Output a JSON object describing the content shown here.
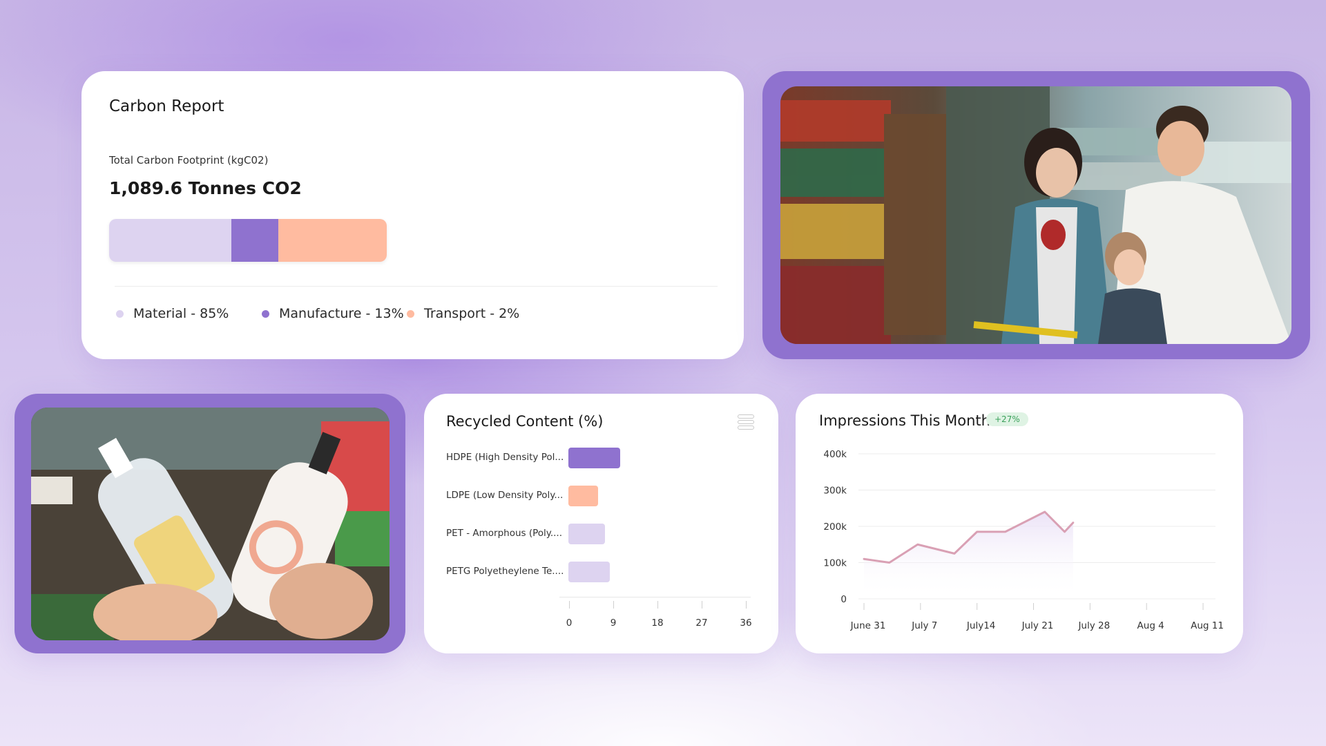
{
  "carbon_report": {
    "title": "Carbon Report",
    "subtitle": "Total Carbon Footprint (kgC02)",
    "total": "1,089.6 Tonnes CO2",
    "segments": [
      {
        "label": "Material - 85%",
        "share": 0.44,
        "color": "#ddd3f0"
      },
      {
        "label": "Manufacture - 13%",
        "share": 0.17,
        "color": "#8f72cf"
      },
      {
        "label": "Transport - 2%",
        "share": 0.39,
        "color": "#ffbba0"
      }
    ]
  },
  "photos": {
    "store_photo": {
      "description": "family shopping in supermarket aisle"
    },
    "bottles_photo": {
      "description": "hands holding eco soap bottles"
    }
  },
  "recycled_content": {
    "title": "Recycled Content (%)",
    "menu_icon": "list-menu-icon",
    "chart_data": {
      "type": "bar",
      "orientation": "horizontal",
      "categories": [
        "HDPE (High Density Pol....",
        "LDPE (Low Density Poly...",
        "PET -  Amorphous (Poly....",
        "PETG Polyetheylene Te...."
      ],
      "values": [
        10.5,
        6,
        7.5,
        8.5
      ],
      "colors": [
        "#8f72cf",
        "#ffbba0",
        "#ddd3f0",
        "#ddd3f0"
      ],
      "xlim": [
        0,
        36
      ],
      "xticks": [
        "0",
        "9",
        "18",
        "27",
        "36"
      ]
    }
  },
  "impressions": {
    "title": "Impressions This Month",
    "badge": "+27%",
    "chart_data": {
      "type": "line",
      "x": [
        "June 31",
        "July 7",
        "July14",
        "July 21",
        "July 28",
        "Aug 4",
        "Aug 11"
      ],
      "yticks": [
        "0",
        "100k",
        "200k",
        "300k",
        "400k"
      ],
      "ylim": [
        0,
        400000
      ],
      "grid": true,
      "points": [
        {
          "x": 0.0,
          "y": 110000
        },
        {
          "x": 0.45,
          "y": 100000
        },
        {
          "x": 0.95,
          "y": 150000
        },
        {
          "x": 1.6,
          "y": 125000
        },
        {
          "x": 2.0,
          "y": 185000
        },
        {
          "x": 2.5,
          "y": 185000
        },
        {
          "x": 3.2,
          "y": 240000
        },
        {
          "x": 3.55,
          "y": 185000
        },
        {
          "x": 3.7,
          "y": 210000
        }
      ],
      "line_color": "#d9a0b4"
    }
  }
}
